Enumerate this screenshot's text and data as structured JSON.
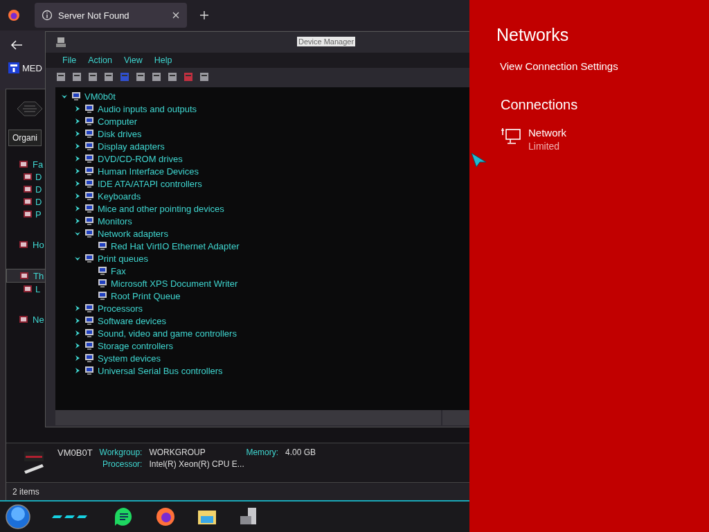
{
  "browser": {
    "tab": {
      "title": "Server Not Found"
    },
    "bookmark": "MED"
  },
  "explorer": {
    "toolbar_button": "Organi",
    "sidebar": [
      {
        "label": "Fa",
        "selected": false,
        "children": [
          {
            "label": "D",
            "selected": false
          },
          {
            "label": "D",
            "selected": false
          },
          {
            "label": "D",
            "selected": false
          },
          {
            "label": "P",
            "selected": false
          }
        ]
      },
      {
        "label": "Ho",
        "selected": false
      },
      {
        "label": "Th",
        "selected": true,
        "children": [
          {
            "label": "L",
            "selected": false
          }
        ]
      },
      {
        "label": "Ne",
        "selected": false
      }
    ],
    "details": {
      "name": "VM0B0T",
      "fields": [
        {
          "label": "Workgroup:",
          "value": "WORKGROUP"
        },
        {
          "label": "Memory:",
          "value": "4.00 GB"
        },
        {
          "label": "Processor:",
          "value": "Intel(R) Xeon(R) CPU E..."
        }
      ]
    },
    "status_bar": "2 items"
  },
  "device_manager": {
    "title": "Device Manager",
    "menu": [
      "File",
      "Action",
      "View",
      "Help"
    ],
    "tree": {
      "label": "VM0b0t",
      "expanded": true,
      "children": [
        {
          "label": "Audio inputs and outputs",
          "expanded": false
        },
        {
          "label": "Computer",
          "expanded": false
        },
        {
          "label": "Disk drives",
          "expanded": false
        },
        {
          "label": "Display adapters",
          "expanded": false
        },
        {
          "label": "DVD/CD-ROM drives",
          "expanded": false
        },
        {
          "label": "Human Interface Devices",
          "expanded": false
        },
        {
          "label": "IDE ATA/ATAPI controllers",
          "expanded": false
        },
        {
          "label": "Keyboards",
          "expanded": false
        },
        {
          "label": "Mice and other pointing devices",
          "expanded": false
        },
        {
          "label": "Monitors",
          "expanded": false
        },
        {
          "label": "Network adapters",
          "expanded": true,
          "children": [
            {
              "label": "Red Hat VirtIO Ethernet Adapter"
            }
          ]
        },
        {
          "label": "Print queues",
          "expanded": true,
          "children": [
            {
              "label": "Fax"
            },
            {
              "label": "Microsoft XPS Document Writer"
            },
            {
              "label": "Root Print Queue"
            }
          ]
        },
        {
          "label": "Processors",
          "expanded": false
        },
        {
          "label": "Software devices",
          "expanded": false
        },
        {
          "label": "Sound, video and game controllers",
          "expanded": false
        },
        {
          "label": "Storage controllers",
          "expanded": false
        },
        {
          "label": "System devices",
          "expanded": false
        },
        {
          "label": "Universal Serial Bus controllers",
          "expanded": false
        }
      ]
    }
  },
  "networks_panel": {
    "title": "Networks",
    "settings_link": "View Connection Settings",
    "section": "Connections",
    "connections": [
      {
        "name": "Network",
        "status": "Limited"
      }
    ]
  }
}
